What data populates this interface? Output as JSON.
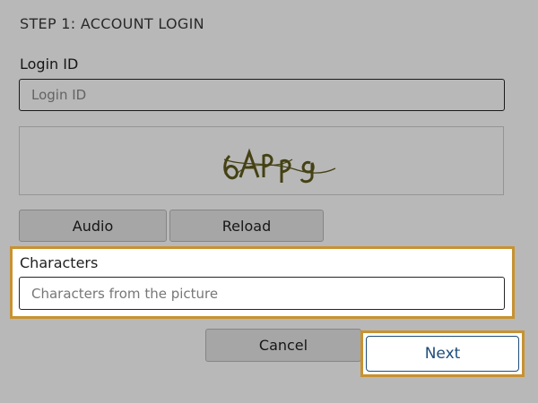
{
  "step_title": "STEP 1: ACCOUNT LOGIN",
  "login": {
    "label": "Login ID",
    "placeholder": "Login ID",
    "value": ""
  },
  "captcha": {
    "text": "6APPg"
  },
  "buttons": {
    "audio": "Audio",
    "reload": "Reload",
    "cancel": "Cancel",
    "next": "Next"
  },
  "characters": {
    "label": "Characters",
    "placeholder": "Characters from the picture",
    "value": ""
  },
  "colors": {
    "highlight": "#c8922f",
    "primary_text": "#1f4d7a",
    "captcha_ink": "#5f5a1c"
  }
}
